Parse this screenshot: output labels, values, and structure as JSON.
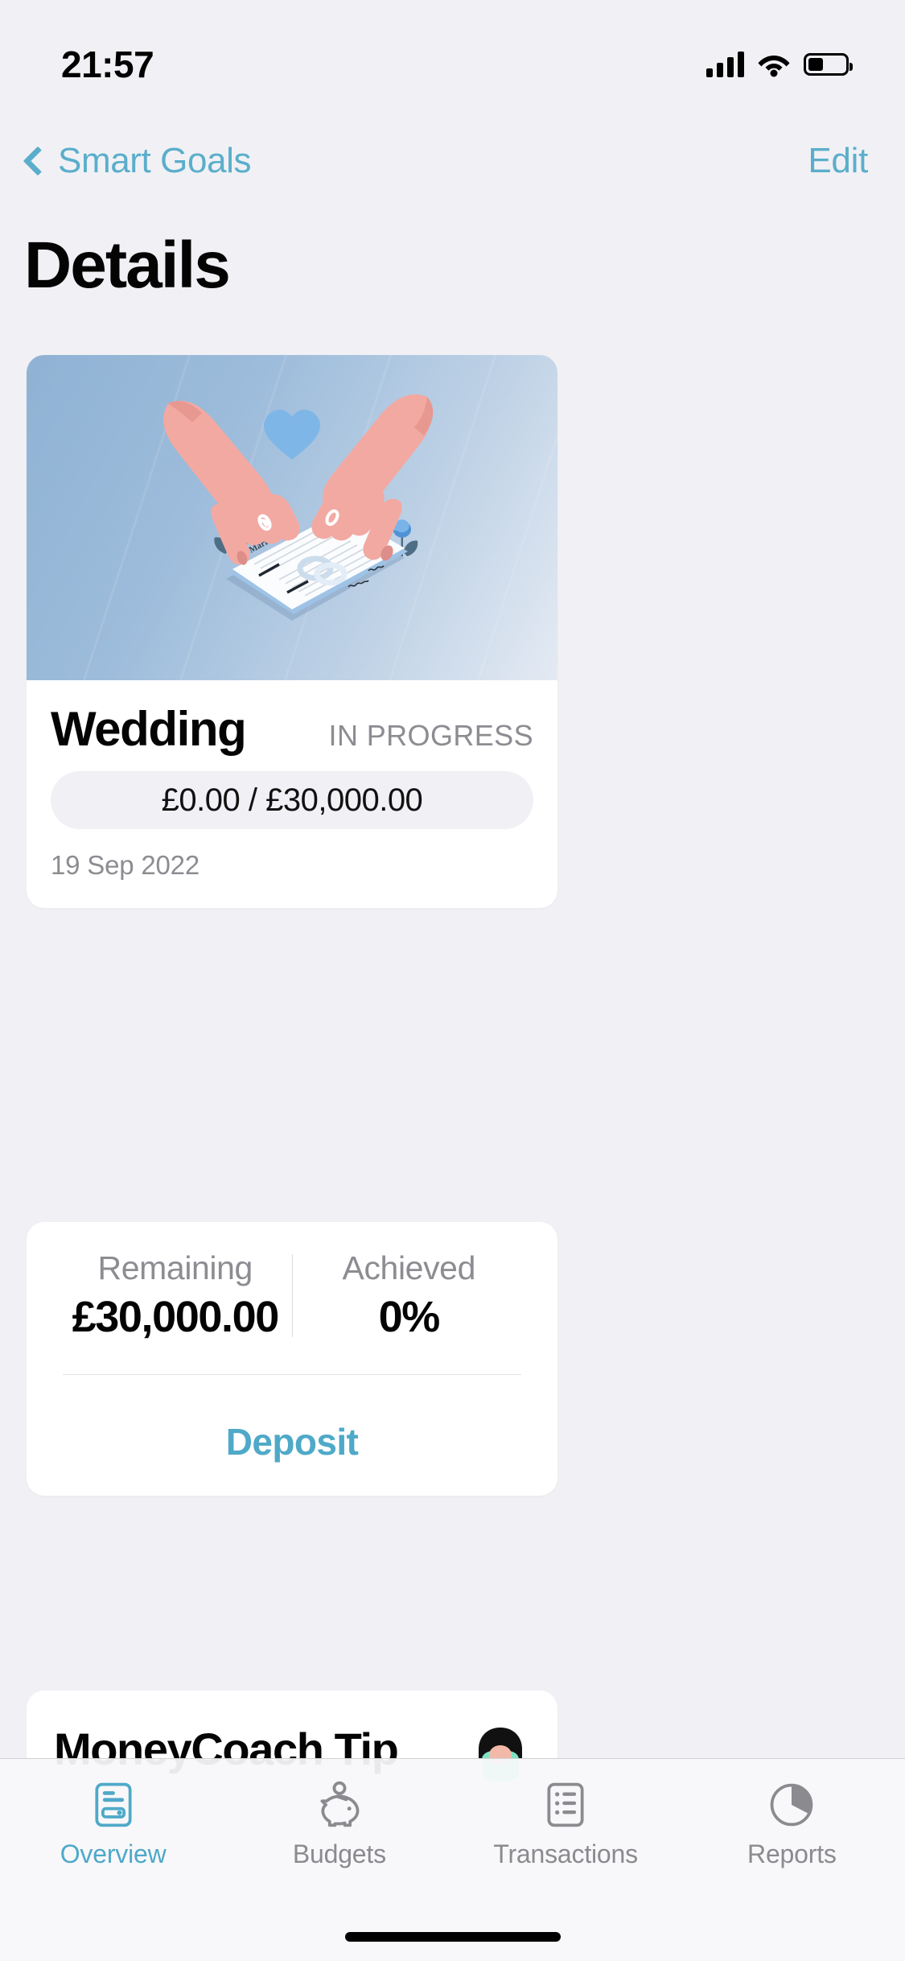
{
  "status_bar": {
    "time": "21:57",
    "cellular_icon": "cellular-bars-icon",
    "wifi_icon": "wifi-icon",
    "battery_icon": "battery-icon",
    "battery_level_pct": 40
  },
  "nav": {
    "back_icon": "chevron-left-icon",
    "back_label": "Smart Goals",
    "edit_label": "Edit"
  },
  "page": {
    "title": "Details",
    "background": "#F1F1F5",
    "accent_color": "#5BAECB"
  },
  "goal": {
    "hero_illustration": "wedding-certificate-illustration",
    "name": "Wedding",
    "status": "IN PROGRESS",
    "progress_text": "£0.00 / £30,000.00",
    "progress_pct": 0,
    "saved_amount": "£0.00",
    "target_amount": "£30,000.00",
    "date": "19 Sep 2022"
  },
  "stats": {
    "remaining_label": "Remaining",
    "remaining_value": "£30,000.00",
    "achieved_label": "Achieved",
    "achieved_value": "0%",
    "deposit_label": "Deposit"
  },
  "tip": {
    "title": "MoneyCoach Tip",
    "avatar_icon": "coach-avatar"
  },
  "tabbar": {
    "items": [
      {
        "label": "Overview",
        "icon": "overview-card-icon",
        "active": true
      },
      {
        "label": "Budgets",
        "icon": "piggy-bank-icon",
        "active": false
      },
      {
        "label": "Transactions",
        "icon": "list-document-icon",
        "active": false
      },
      {
        "label": "Reports",
        "icon": "pie-chart-icon",
        "active": false
      }
    ],
    "active_color": "#4FA9C8",
    "inactive_color": "#8A8A8F"
  }
}
